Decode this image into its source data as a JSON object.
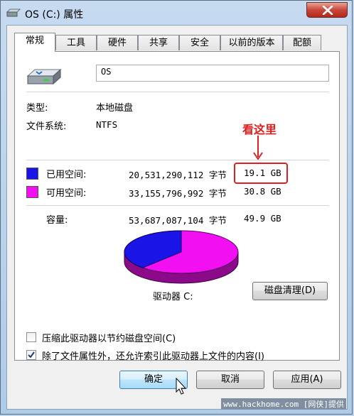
{
  "window": {
    "title": "OS (C:) 属性",
    "icons": {
      "title": "drive-icon",
      "close": "close-icon"
    }
  },
  "tabs": [
    {
      "label": "常规",
      "active": true
    },
    {
      "label": "工具"
    },
    {
      "label": "硬件"
    },
    {
      "label": "共享"
    },
    {
      "label": "安全"
    },
    {
      "label": "以前的版本"
    },
    {
      "label": "配额"
    }
  ],
  "general": {
    "name_value": "OS",
    "type_label": "类型:",
    "type_value": "本地磁盘",
    "fs_label": "文件系统:",
    "fs_value": "NTFS",
    "used_label": "已用空间:",
    "used_bytes": "20,531,290,112 字节",
    "used_gb": "19.1 GB",
    "free_label": "可用空间:",
    "free_bytes": "33,155,796,992 字节",
    "free_gb": "30.8 GB",
    "capacity_label": "容量:",
    "capacity_bytes": "53,687,087,104 字节",
    "capacity_gb": "49.9 GB",
    "drive_label": "驱动器 C:",
    "cleanup_button": "磁盘清理(D)",
    "compress_label": "压缩此驱动器以节约磁盘空间(C)",
    "compress_checked": false,
    "index_label": "除了文件属性外，还允许索引此驱动器上文件的内容(I)",
    "index_checked": true,
    "colors": {
      "used": "#1a14e6",
      "free": "#f20ff2"
    },
    "usage": {
      "used_fraction": 0.382
    }
  },
  "annotation": {
    "text": "看这里",
    "color": "#e02020"
  },
  "buttons": {
    "ok": "确定",
    "cancel": "取消",
    "apply": "应用(A)"
  },
  "watermark": "www.hackhome.com [网侠]提供"
}
